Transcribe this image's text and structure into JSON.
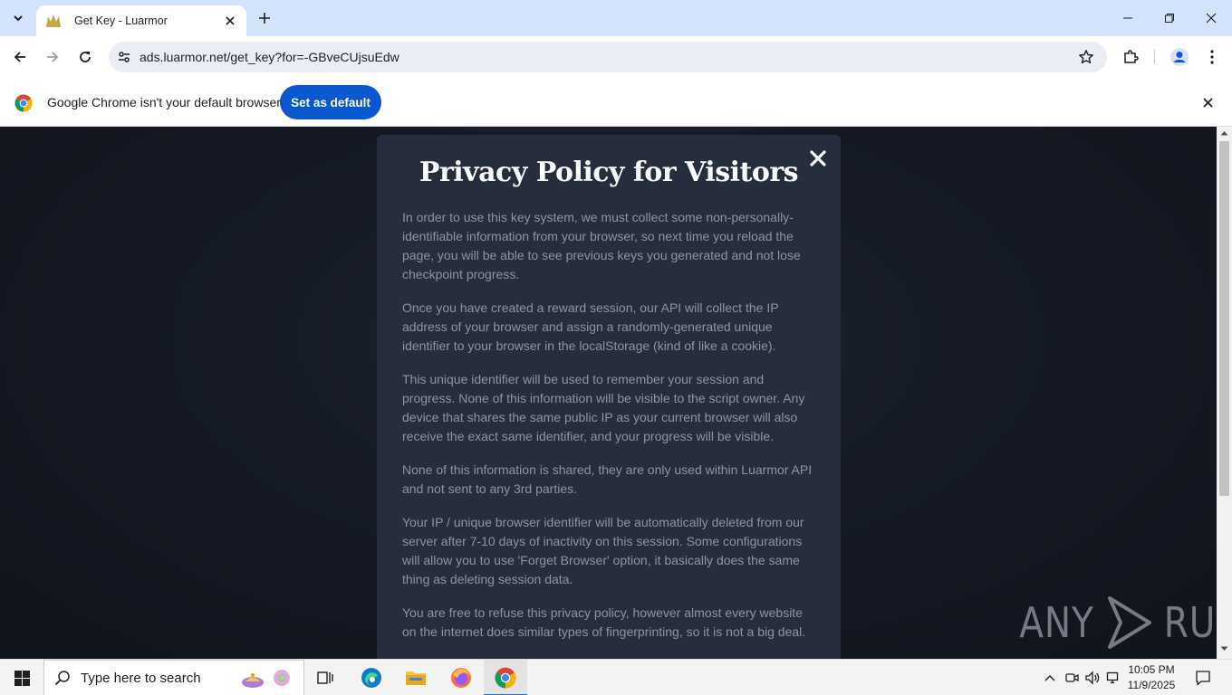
{
  "browser": {
    "tab_title": "Get Key - Luarmor",
    "url": "ads.luarmor.net/get_key?for=-GBveCUjsuEdw"
  },
  "infobar": {
    "message": "Google Chrome isn't your default browser",
    "button_label": "Set as default"
  },
  "modal": {
    "title": "Privacy Policy for Visitors",
    "paragraphs": [
      "In order to use this key system, we must collect some non-personally-identifiable information from your browser, so next time you reload the page, you will be able to see previous keys you generated and not lose checkpoint progress.",
      "Once you have created a reward session, our API will collect the IP address of your browser and assign a randomly-generated unique identifier to your browser in the localStorage (kind of like a cookie).",
      "This unique identifier will be used to remember your session and progress. None of this information will be visible to the script owner. Any device that shares the same public IP as your current browser will also receive the exact same identifier, and your progress will be visible.",
      "None of this information is shared, they are only used within Luarmor API and not sent to any 3rd parties.",
      "Your IP / unique browser identifier will be automatically deleted from our server after 7-10 days of inactivity on this session. Some configurations will allow you to use 'Forget Browser' option, it basically does the same thing as deleting session data.",
      "You are free to refuse this privacy policy, however almost every website on the internet does similar types of fingerprinting, so it is not a big deal."
    ]
  },
  "watermark": {
    "left": "ANY",
    "right": "RUN"
  },
  "taskbar": {
    "search_placeholder": "Type here to search",
    "time": "10:05 PM",
    "date": "11/9/2025"
  },
  "colors": {
    "accent": "#0b57d0",
    "tab_strip": "#d3e3fd",
    "modal_bg": "#262d3c",
    "page_bg": "#151a25"
  },
  "icons": {
    "tab_search": "chevron-down-icon",
    "favicon": "luarmor-favicon",
    "close": "close-icon",
    "new_tab": "plus-icon",
    "back": "arrow-left-icon",
    "forward": "arrow-right-icon",
    "reload": "reload-icon",
    "site_info": "tune-icon",
    "bookmark": "star-icon",
    "extensions": "puzzle-icon",
    "profile": "profile-icon",
    "menu": "kebab-icon"
  }
}
